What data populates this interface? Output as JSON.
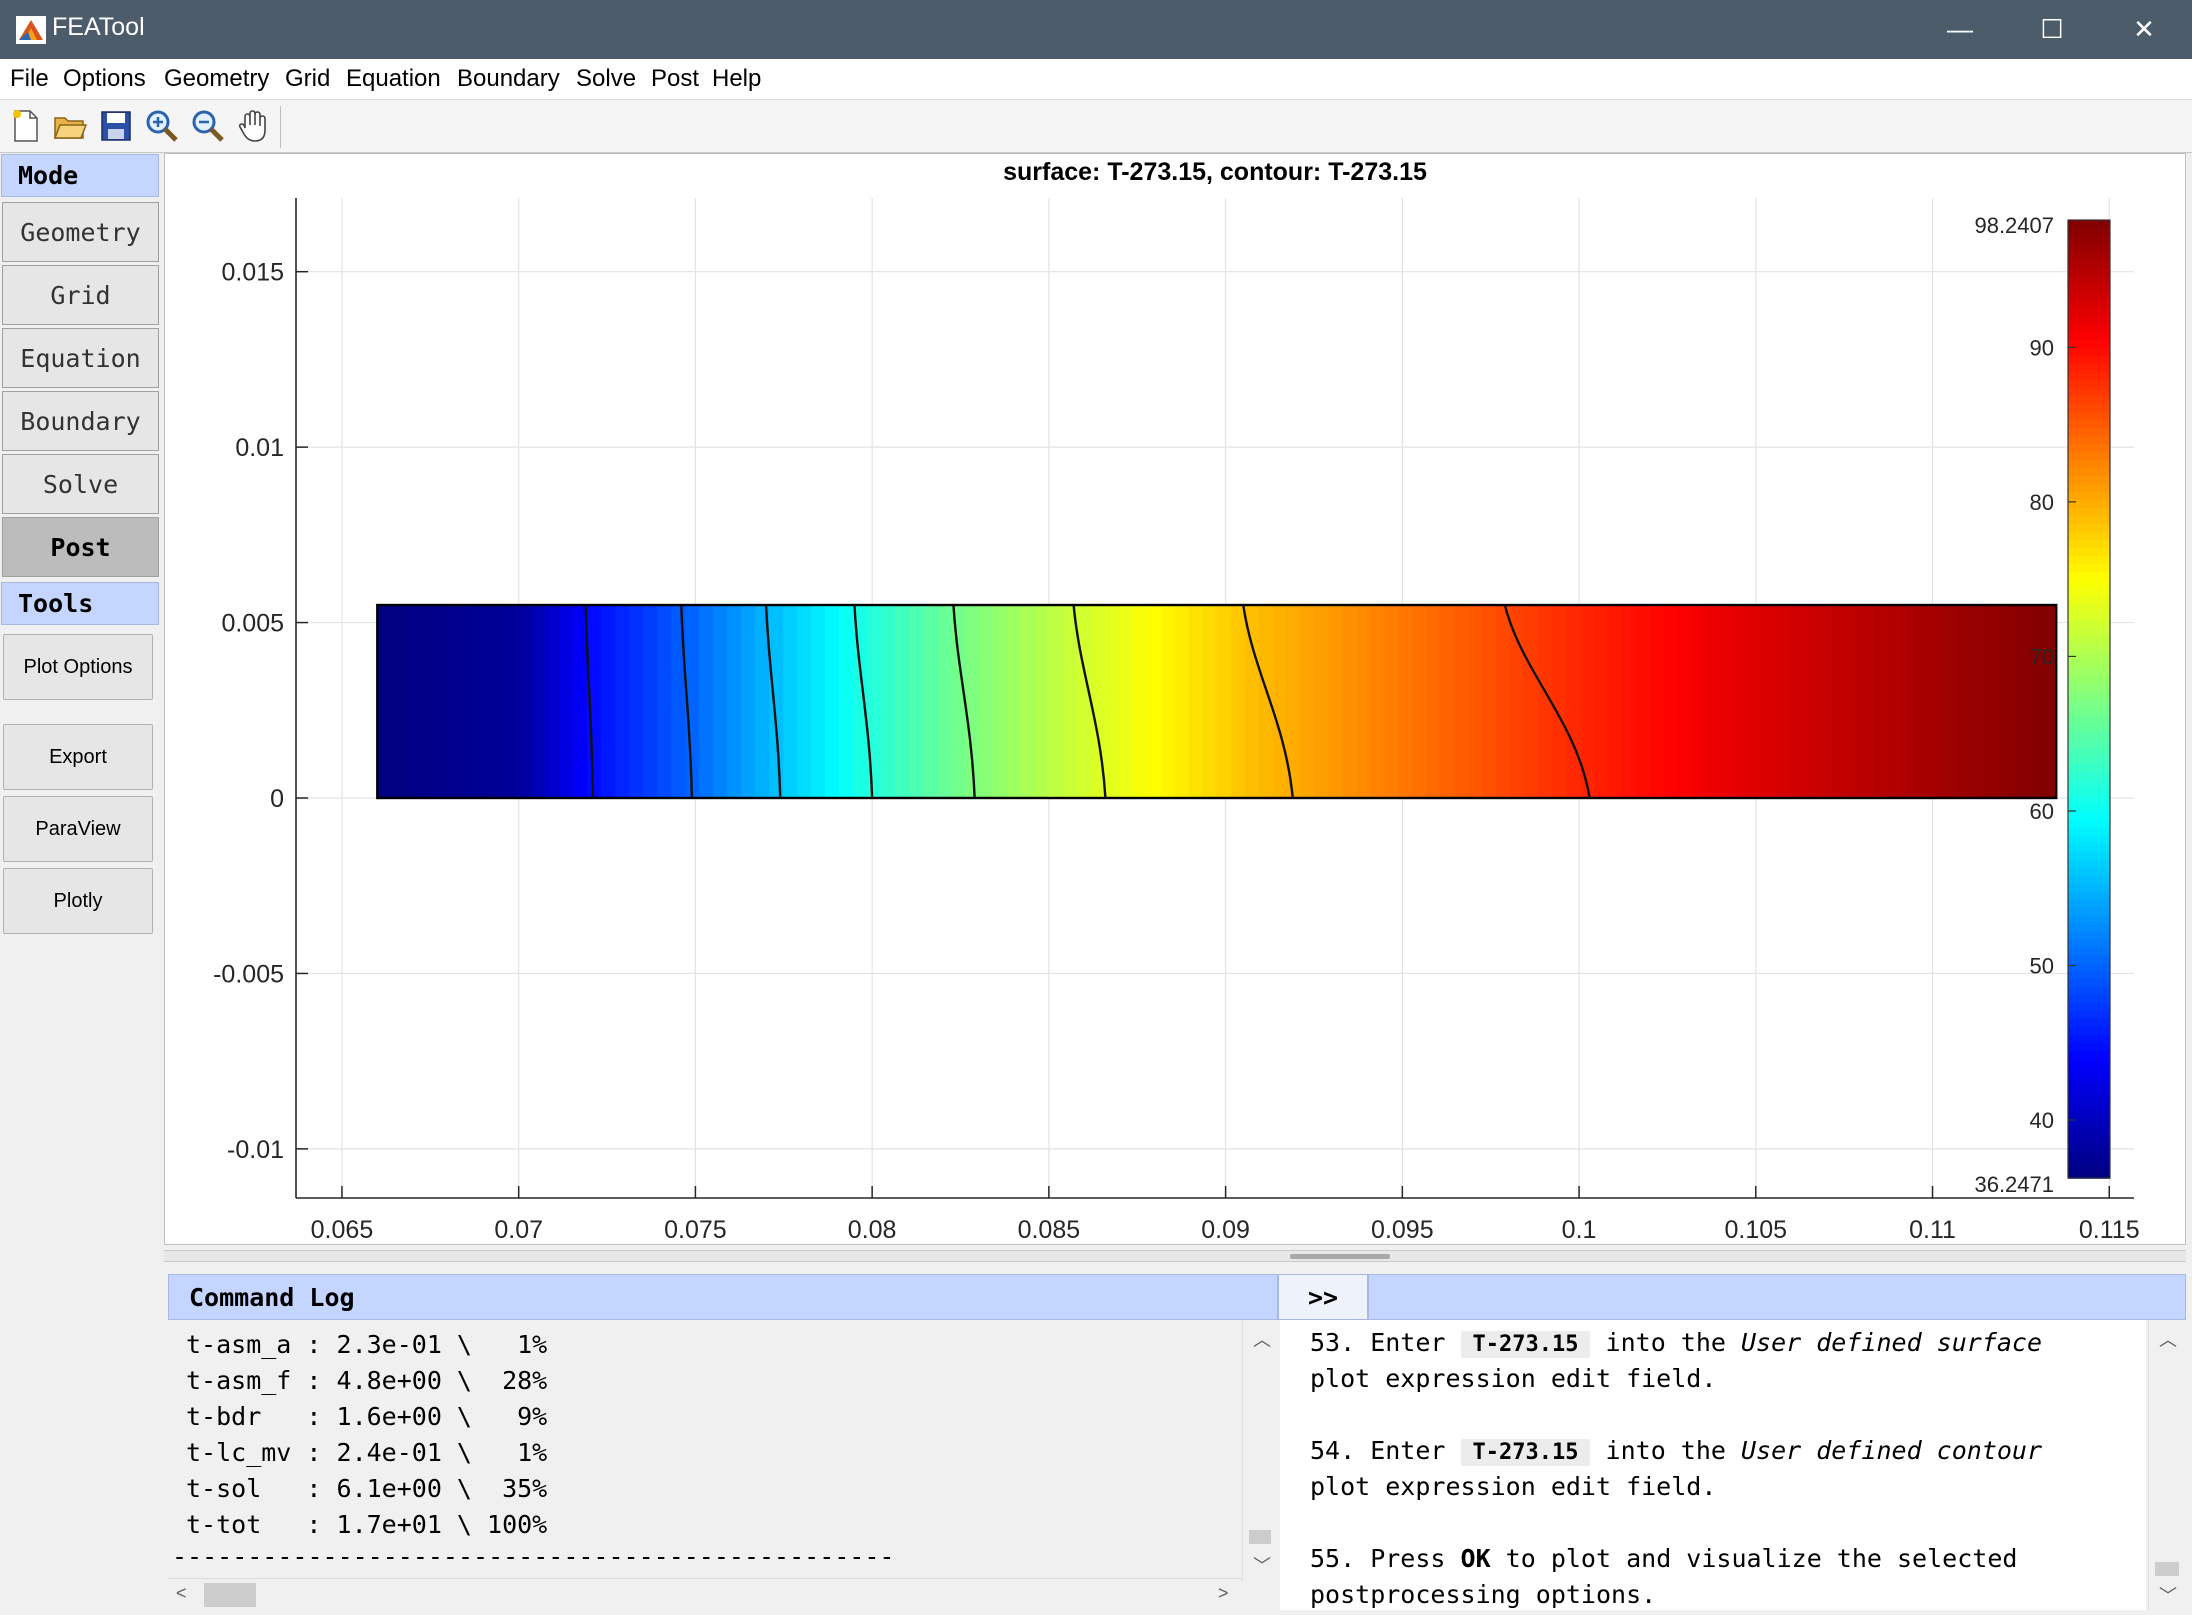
{
  "window": {
    "title": "FEATool",
    "controls": [
      "—",
      "☐",
      "✕"
    ]
  },
  "menu": [
    "File",
    "Options",
    "Geometry",
    "Grid",
    "Equation",
    "Boundary",
    "Solve",
    "Post",
    "Help"
  ],
  "toolbar": [
    "new-file",
    "open-folder",
    "save",
    "zoom-in",
    "zoom-out",
    "pan"
  ],
  "sidebar": {
    "mode_header": "Mode",
    "modes": [
      "Geometry",
      "Grid",
      "Equation",
      "Boundary",
      "Solve",
      "Post"
    ],
    "active_mode": "Post",
    "tools_header": "Tools",
    "tools": [
      "Plot Options",
      "Export",
      "ParaView",
      "Plotly"
    ]
  },
  "chart_data": {
    "type": "heatmap",
    "title": "surface: T-273.15, contour: T-273.15",
    "xlim": [
      0.0637,
      0.1157
    ],
    "ylim": [
      -0.0114,
      0.0171
    ],
    "x_ticks": [
      0.065,
      0.07,
      0.075,
      0.08,
      0.085,
      0.09,
      0.095,
      0.1,
      0.105,
      0.11,
      0.115
    ],
    "x_tick_labels": [
      "0.065",
      "0.07",
      "0.075",
      "0.08",
      "0.085",
      "0.09",
      "0.095",
      "0.1",
      "0.105",
      "0.11",
      "0.115"
    ],
    "y_ticks": [
      0.015,
      0.01,
      0.005,
      0,
      -0.005,
      -0.01
    ],
    "y_tick_labels": [
      "0.015",
      "0.01",
      "0.005",
      "0",
      "-0.005",
      "-0.01"
    ],
    "grid": true,
    "domain": {
      "x": [
        0.066,
        0.1135
      ],
      "y": [
        0,
        0.0055
      ]
    },
    "colorbar": {
      "min": 36.2471,
      "max": 98.2407,
      "min_label": "36.2471",
      "max_label": "98.2407",
      "ticks": [
        40,
        50,
        60,
        70,
        80,
        90
      ],
      "tick_labels": [
        "40",
        "50",
        "60",
        "70",
        "80",
        "90"
      ],
      "colormap": "jet"
    },
    "surface_profile": [
      [
        0.066,
        36.2471
      ],
      [
        0.07,
        37.8
      ],
      [
        0.072,
        44.4
      ],
      [
        0.0748,
        49.9
      ],
      [
        0.0772,
        55.4
      ],
      [
        0.0796,
        60.9
      ],
      [
        0.0824,
        66.5
      ],
      [
        0.0858,
        72.0
      ],
      [
        0.0908,
        79.0
      ],
      [
        0.0998,
        88.0
      ],
      [
        0.105,
        92.5
      ],
      [
        0.11,
        96.0
      ],
      [
        0.1135,
        98.2407
      ]
    ],
    "contours": [
      {
        "level": 44.4,
        "x_top": 0.0719,
        "x_bottom": 0.0721
      },
      {
        "level": 49.9,
        "x_top": 0.0746,
        "x_bottom": 0.0749
      },
      {
        "level": 55.4,
        "x_top": 0.077,
        "x_bottom": 0.0774
      },
      {
        "level": 60.9,
        "x_top": 0.0795,
        "x_bottom": 0.08
      },
      {
        "level": 66.5,
        "x_top": 0.0823,
        "x_bottom": 0.0829
      },
      {
        "level": 72.0,
        "x_top": 0.0857,
        "x_bottom": 0.0866
      },
      {
        "level": 79.0,
        "x_top": 0.0905,
        "x_bottom": 0.0919
      },
      {
        "level": 88.0,
        "x_top": 0.0979,
        "x_bottom": 0.1003
      }
    ]
  },
  "log": {
    "header": "Command Log",
    "expand_label": ">>",
    "lines": [
      "t-asm_a : 2.3e-01 \\   1%",
      "t-asm_f : 4.8e+00 \\  28%",
      "t-bdr   : 1.6e+00 \\   9%",
      "t-lc_mv : 2.4e-01 \\   1%",
      "t-sol   : 6.1e+00 \\  35%",
      "t-tot   : 1.7e+01 \\ 100%",
      "------------------------------------------------"
    ]
  },
  "help": {
    "step53_a": "53. Enter ",
    "step53_code": "T-273.15",
    "step53_b": " into the ",
    "step53_i": "User defined surface",
    "step53_c": "plot expression edit field.",
    "step54_a": "54. Enter ",
    "step54_code": "T-273.15",
    "step54_b": " into the ",
    "step54_i": "User defined contour",
    "step54_c": "plot expression edit field.",
    "step55_a": "55. Press ",
    "step55_b": "OK",
    "step55_c": " to plot and visualize the selected",
    "step55_d": "postprocessing options."
  }
}
